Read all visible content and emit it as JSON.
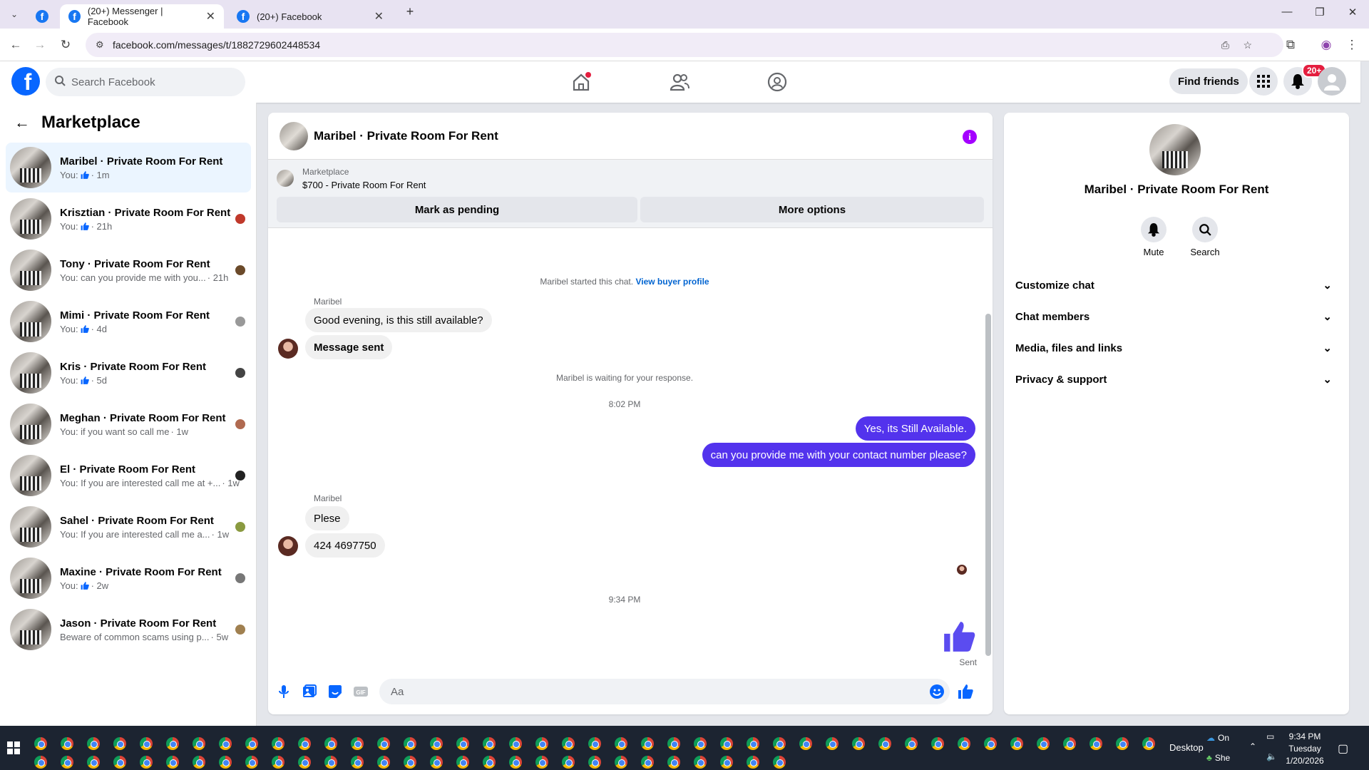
{
  "browser": {
    "tabs": [
      {
        "label": "(20+) Messenger | Facebook"
      },
      {
        "label": "(20+) Facebook"
      }
    ],
    "url": "facebook.com/messages/t/1882729602448534"
  },
  "header": {
    "search_placeholder": "Search Facebook",
    "find_friends": "Find friends",
    "notif_badge": "20+"
  },
  "sidebar": {
    "title": "Marketplace",
    "conversations": [
      {
        "name": "Maribel · Private Room For Rent",
        "prefix": "You:",
        "thumb": true,
        "time": "· 1m"
      },
      {
        "name": "Krisztian · Private Room For Rent",
        "prefix": "You:",
        "thumb": true,
        "time": "· 21h"
      },
      {
        "name": "Tony · Private Room For Rent",
        "prefix": "You: can you provide me with you...",
        "thumb": false,
        "time": "· 21h"
      },
      {
        "name": "Mimi · Private Room For Rent",
        "prefix": "You:",
        "thumb": true,
        "time": "· 4d"
      },
      {
        "name": "Kris · Private Room For Rent",
        "prefix": "You:",
        "thumb": true,
        "time": "· 5d"
      },
      {
        "name": "Meghan · Private Room For Rent",
        "prefix": "You: if you want so call me",
        "thumb": false,
        "time": "· 1w"
      },
      {
        "name": "El · Private Room For Rent",
        "prefix": "You: If you are interested call me at +...",
        "thumb": false,
        "time": "· 1w"
      },
      {
        "name": "Sahel · Private Room For Rent",
        "prefix": "You: If you are interested call me a...",
        "thumb": false,
        "time": "· 1w"
      },
      {
        "name": "Maxine · Private Room For Rent",
        "prefix": "You:",
        "thumb": true,
        "time": "· 2w"
      },
      {
        "name": "Jason · Private Room For Rent",
        "prefix": "Beware of common scams using p...",
        "thumb": false,
        "time": "· 5w"
      }
    ]
  },
  "chat": {
    "title": "Maribel · Private Room For Rent",
    "marketplace_label": "Marketplace",
    "listing": "$700 - Private Room For Rent",
    "mark_pending": "Mark as pending",
    "more_options": "More options",
    "started": "Maribel started this chat.",
    "view_buyer": "View buyer profile",
    "sender1": "Maribel",
    "msg1": "Good evening, is this still available?",
    "msg2": "Message sent",
    "waiting": "Maribel is waiting for your response.",
    "time1": "8:02 PM",
    "out1": "Yes, its Still Available.",
    "out2": "can you provide me with your contact number please?",
    "sender2": "Maribel",
    "msg3": "Plese",
    "msg4": "424 4697750",
    "time2": "9:34 PM",
    "sent": "Sent",
    "compose_placeholder": "Aa"
  },
  "details": {
    "name": "Maribel · Private Room For Rent",
    "mute": "Mute",
    "search": "Search",
    "sections": [
      "Customize chat",
      "Chat members",
      "Media, files and links",
      "Privacy & support"
    ]
  },
  "taskbar": {
    "desktop": "Desktop",
    "onedrive": "On",
    "she": "She",
    "time": "9:34 PM",
    "day": "Tuesday",
    "date": "1/20/2026"
  },
  "colors": {
    "accent": "#0866ff",
    "outgoing": "#5333ed",
    "like": "#5b4cf0"
  }
}
